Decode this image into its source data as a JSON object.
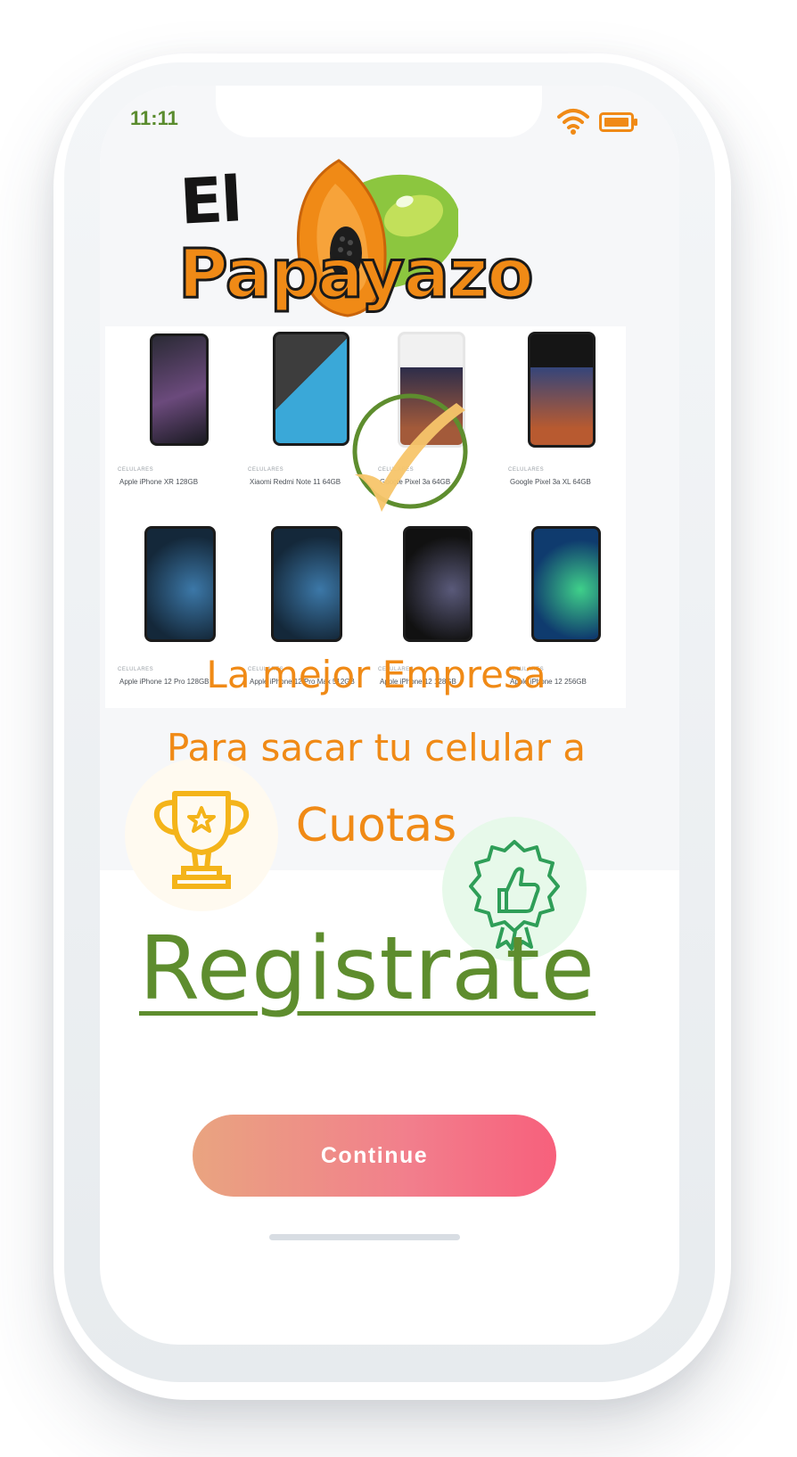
{
  "status_bar": {
    "time": "11:11",
    "wifi_icon": "wifi-icon",
    "battery_icon": "battery-icon",
    "accent_color": "#f08a16"
  },
  "brand": {
    "line1": "El",
    "line2": "Papayazo",
    "logo_icon": "papaya-icon"
  },
  "products": [
    {
      "category": "CELULARES",
      "name": "Apple iPhone XR 128GB"
    },
    {
      "category": "CELULARES",
      "name": "Xiaomi Redmi Note 11 64GB"
    },
    {
      "category": "CELULARES",
      "name": "Google Pixel 3a 64GB"
    },
    {
      "category": "CELULARES",
      "name": "Google Pixel 3a XL 64GB"
    },
    {
      "category": "CELULARES",
      "name": "Apple iPhone 12 Pro 128GB"
    },
    {
      "category": "CELULARES",
      "name": "Apple iPhone 12 Pro Max 512GB"
    },
    {
      "category": "CELULARES",
      "name": "Apple iPhone 12 128GB"
    },
    {
      "category": "CELULARES",
      "name": "Apple iPhone 12 256GB"
    }
  ],
  "headline": {
    "line1": "La mejor Empresa",
    "line2": "Para sacar tu celular a",
    "line3": "Cuotas"
  },
  "badges": {
    "trophy_icon": "trophy-icon",
    "thumbs_icon": "thumbs-up-badge-icon",
    "check_icon": "check-circle-icon"
  },
  "register": {
    "label": "Registrate"
  },
  "actions": {
    "continue_label": "Continue"
  },
  "colors": {
    "brand_orange": "#f08a16",
    "brand_green": "#5e8d2e",
    "button_start": "#e9a480",
    "button_end": "#f7607c"
  }
}
